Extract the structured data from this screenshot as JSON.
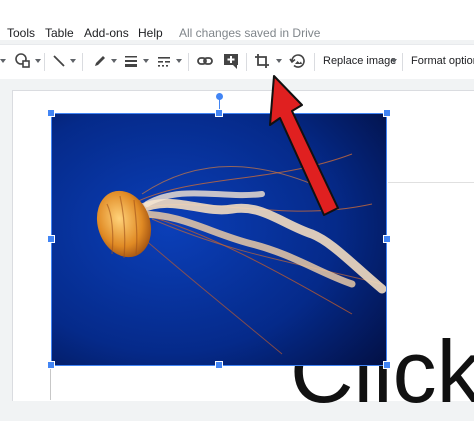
{
  "menu": {
    "items": [
      {
        "id": "tools",
        "label": "Tools"
      },
      {
        "id": "table",
        "label": "Table"
      },
      {
        "id": "addons",
        "label": "Add-ons"
      },
      {
        "id": "help",
        "label": "Help"
      }
    ],
    "save_status": "All changes saved in Drive"
  },
  "toolbar": {
    "icons": [
      "shape-icon",
      "line-icon",
      "pen-icon",
      "border-weight-icon",
      "border-dash-icon",
      "link-icon",
      "comment-icon",
      "crop-icon",
      "reset-image-icon"
    ],
    "replace_image_label": "Replace image",
    "format_options_label": "Format options"
  },
  "canvas": {
    "text_fragment": "Click"
  },
  "annotation": {
    "arrow_color": "#e02020"
  },
  "colors": {
    "selection": "#4285f4"
  }
}
